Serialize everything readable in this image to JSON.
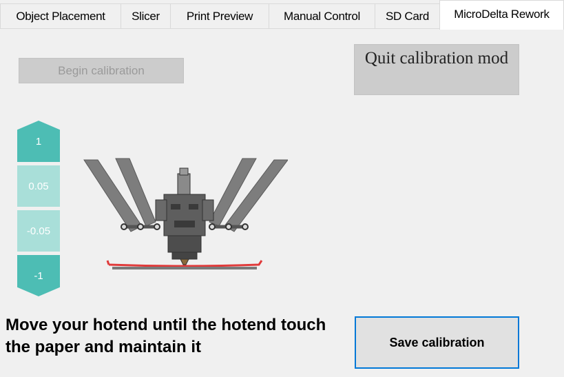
{
  "tabs": [
    {
      "label": "Object Placement",
      "active": false
    },
    {
      "label": "Slicer",
      "active": false
    },
    {
      "label": "Print Preview",
      "active": false
    },
    {
      "label": "Manual Control",
      "active": false
    },
    {
      "label": "SD Card",
      "active": false
    },
    {
      "label": "MicroDelta Rework",
      "active": true
    }
  ],
  "buttons": {
    "begin_calibration": "Begin calibration",
    "quit_calibration": "Quit calibration mod",
    "save_calibration": "Save calibration"
  },
  "steps": [
    "1",
    "0.05",
    "-0.05",
    "-1"
  ],
  "instruction": "Move your hotend until the hotend touch the paper and maintain it",
  "colors": {
    "step_major": "#4dbdb4",
    "step_minor": "#a9dfd9",
    "focus_border": "#0078d7",
    "bed_paper": "#e03a3a"
  },
  "illustration": "delta-printer-hotend"
}
